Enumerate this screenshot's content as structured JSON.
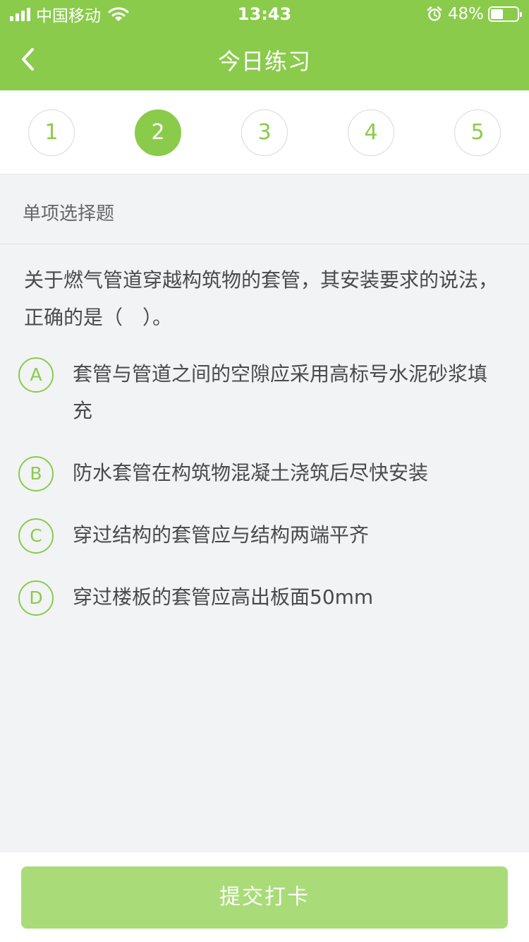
{
  "status_bar": {
    "carrier": "中国移动",
    "time": "13:43",
    "battery_percent": "48%",
    "battery_level": 0.48
  },
  "nav": {
    "title": "今日练习",
    "back_icon": "chevron-left-icon"
  },
  "steps": {
    "items": [
      "1",
      "2",
      "3",
      "4",
      "5"
    ],
    "active": "2"
  },
  "question": {
    "type_label": "单项选择题",
    "text": "关于燃气管道穿越构筑物的套管，其安装要求的说法，正确的是（　）。",
    "options": [
      {
        "key": "A",
        "text": "套管与管道之间的空隙应采用高标号水泥砂浆填充"
      },
      {
        "key": "B",
        "text": "防水套管在构筑物混凝土浇筑后尽快安装"
      },
      {
        "key": "C",
        "text": "穿过结构的套管应与结构两端平齐"
      },
      {
        "key": "D",
        "text": "穿过楼板的套管应高出板面50mm"
      }
    ]
  },
  "footer": {
    "submit_label": "提交打卡"
  },
  "colors": {
    "accent": "#8acb4b",
    "button_disabled": "#a9dc78",
    "background": "#f2f3f5"
  }
}
